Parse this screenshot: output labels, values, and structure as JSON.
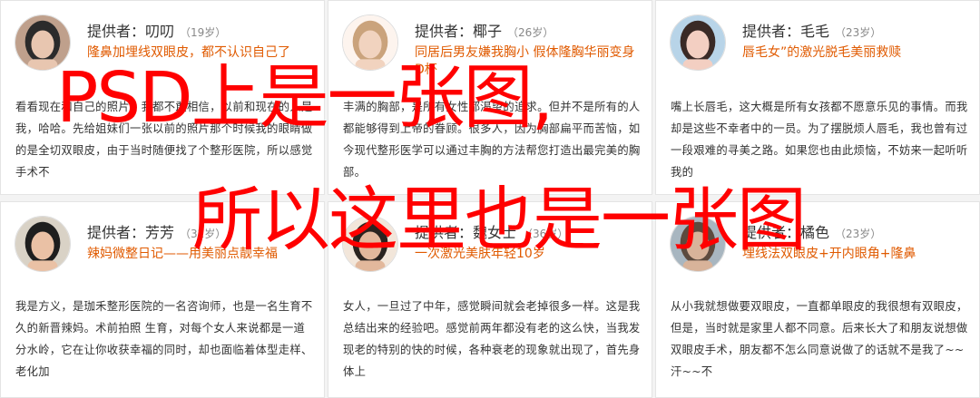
{
  "cards": [
    {
      "provider": "提供者：叨叨",
      "age": "（19岁）",
      "topic": "隆鼻加埋线双眼皮，都不认识自己了",
      "desc": "看看现在和自己的照片，我都不敢相信，以前和现在的人是我，哈哈。先给姐妹们一张以前的照片那个时候我的眼睛做的是全切双眼皮，由于当时随便找了个整形医院，所以感觉手术不",
      "avatar_colors": [
        "#2b2b2b",
        "#e8c6b0",
        "#bfa08c"
      ]
    },
    {
      "provider": "提供者：椰子",
      "age": "（26岁）",
      "topic": "同居后男友嫌我胸小 假体隆胸华丽变身D杯",
      "desc": "丰满的胸部，是所有女性都渴望的追求。但并不是所有的人都能够得到上帝的眷顾。很多人，因为胸部扁平而苦恼，如今现代整形医学可以通过丰胸的方法帮您打造出最完美的胸部。",
      "avatar_colors": [
        "#caa37c",
        "#f1d3bf",
        "#fdf4ee"
      ]
    },
    {
      "provider": "提供者：毛毛",
      "age": "（23岁）",
      "topic": "唇毛女”的激光脱毛美丽救赎",
      "desc": "嘴上长唇毛，这大概是所有女孩都不愿意乐见的事情。而我却是这些不幸者中的一员。为了摆脱烦人唇毛，我也曾有过一段艰难的寻美之路。如果您也由此烦恼，不妨来一起听听我的",
      "avatar_colors": [
        "#3a2a26",
        "#f3cfc2",
        "#b8d4e8"
      ]
    },
    {
      "provider": "提供者：芳芳",
      "age": "（32岁）",
      "topic": "辣妈微整日记——用美丽点靓幸福",
      "desc": "我是方义，是珈禾整形医院的一名咨询师，也是一名生育不久的新晋辣妈。术前拍照 生育，对每个女人来说都是一道分水岭，它在让你收获幸福的同时，却也面临着体型走样、老化加",
      "avatar_colors": [
        "#1e1e1e",
        "#eac1a5",
        "#d9d2c6"
      ]
    },
    {
      "provider": "提供者：魏女士",
      "age": "（36岁）",
      "topic": "一次激光美肤年轻10岁",
      "desc": "女人，一旦过了中年，感觉瞬间就会老掉很多一样。这是我总结出来的经验吧。感觉前两年都没有老的这么快，当我发现老的特别的快的时候，各种衰老的现象就出现了，首先身体上",
      "avatar_colors": [
        "#2a2420",
        "#e2b89c",
        "#f2e6da"
      ]
    },
    {
      "provider": "提供者：橘色",
      "age": "（23岁）",
      "topic": "埋线法双眼皮+开内眼角+隆鼻",
      "desc": "从小我就想做要双眼皮，一直都单眼皮的我很想有双眼皮，但是，当时就是家里人都不同意。后来长大了和朋友说想做双眼皮手术，朋友都不怎么同意说做了的话就不是我了~~ 汗~~不",
      "avatar_colors": [
        "#5c4a3e",
        "#d8b39a",
        "#a8b6c0"
      ]
    }
  ],
  "overlay": {
    "line1": "PSD上是一张图,",
    "line2": "所以这里也是一张图",
    "color": "#ff0000"
  },
  "accent_color": "#e05a00"
}
